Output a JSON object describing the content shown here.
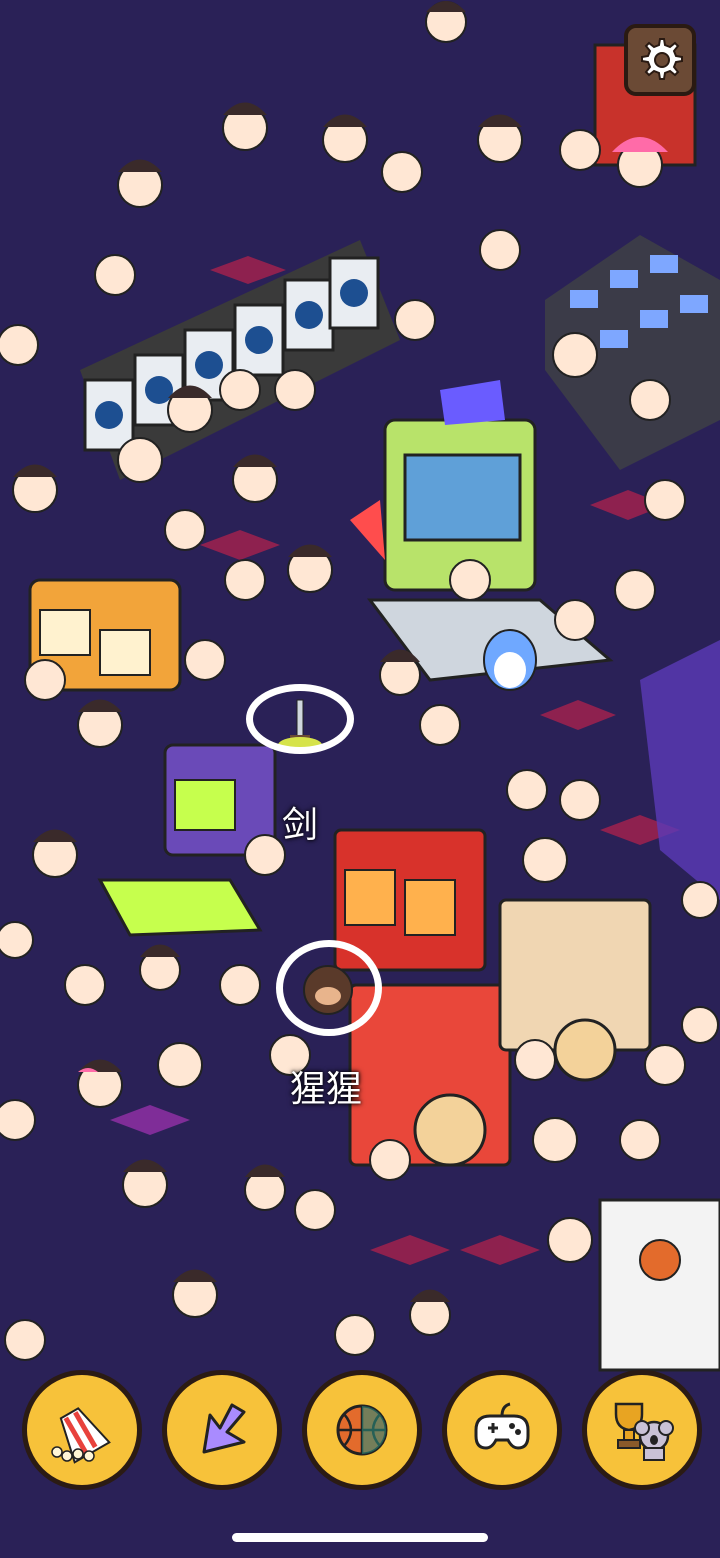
{
  "found_items": [
    {
      "id": "sword",
      "label": "剑"
    },
    {
      "id": "gorilla",
      "label": "猩猩"
    }
  ],
  "toolbar": {
    "items": [
      {
        "icon": "popcorn-icon"
      },
      {
        "icon": "arrow-icon"
      },
      {
        "icon": "basketball-icon"
      },
      {
        "icon": "gamepad-icon"
      },
      {
        "icon": "trophy-koala-icon"
      }
    ]
  },
  "colors": {
    "background": "#2a2157",
    "toolbar_button": "#f7c23a",
    "settings_button": "#6b4a35",
    "ring": "#ffffff"
  }
}
